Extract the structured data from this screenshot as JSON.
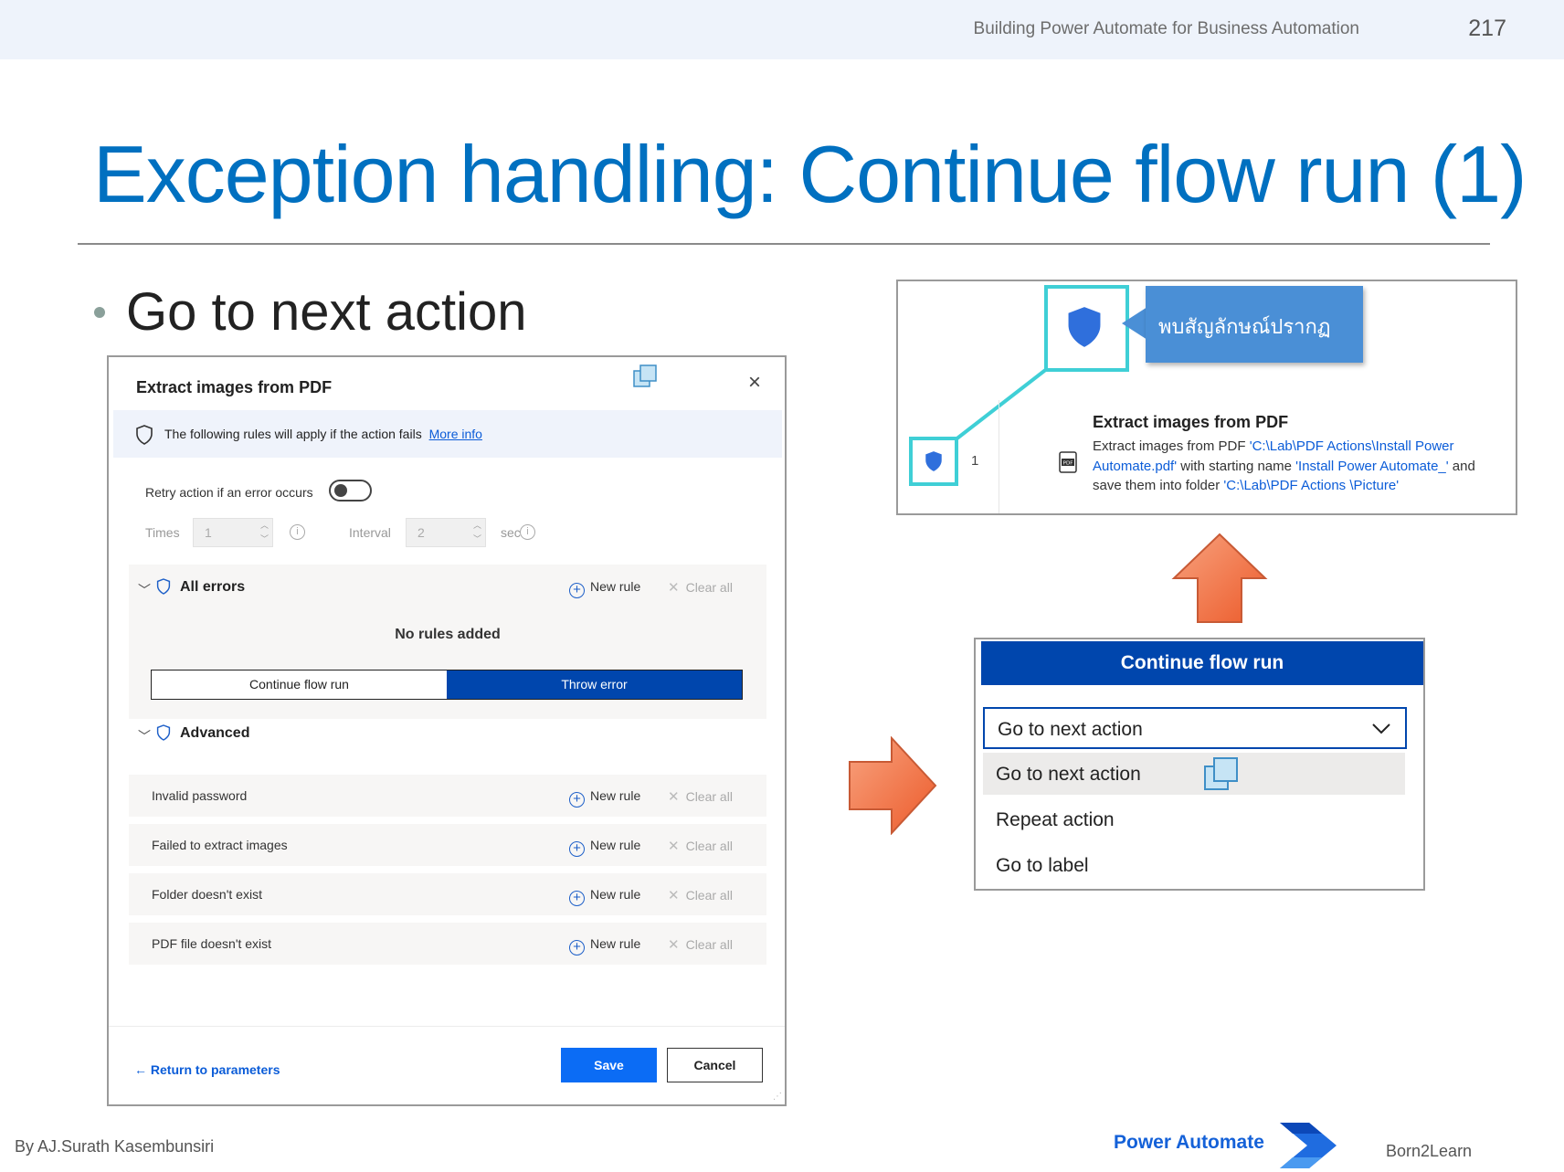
{
  "header": {
    "book_title": "Building Power Automate for Business Automation",
    "page_number": "217"
  },
  "slide": {
    "title": "Exception handling: Continue flow run (1)",
    "bullet": "Go to next action"
  },
  "dialog": {
    "title": "Extract images from PDF",
    "info_text": "The following rules will apply if the action fails",
    "info_link": "More info",
    "retry_label": "Retry action if an error occurs",
    "retry_enabled": false,
    "times_label": "Times",
    "times_value": "1",
    "interval_label": "Interval",
    "interval_value": "2",
    "interval_unit": "sec",
    "all_errors": {
      "heading": "All errors",
      "new_rule": "New rule",
      "clear_all": "Clear all",
      "empty_text": "No rules added",
      "continue_label": "Continue flow run",
      "throw_label": "Throw error"
    },
    "advanced": {
      "heading": "Advanced",
      "rows": [
        {
          "label": "Invalid password",
          "new_rule": "New rule",
          "clear_all": "Clear all"
        },
        {
          "label": "Failed to extract images",
          "new_rule": "New rule",
          "clear_all": "Clear all"
        },
        {
          "label": "Folder doesn't exist",
          "new_rule": "New rule",
          "clear_all": "Clear all"
        },
        {
          "label": "PDF file doesn't exist",
          "new_rule": "New rule",
          "clear_all": "Clear all"
        }
      ]
    },
    "return_link": "Return to parameters",
    "save_label": "Save",
    "cancel_label": "Cancel"
  },
  "flow_step": {
    "callout": "พบสัญลักษณ์ปรากฏ",
    "step_number": "1",
    "action_title": "Extract images from PDF",
    "desc_1": "Extract images from PDF ",
    "desc_path1": "'C:\\Lab\\PDF Actions\\Install Power Automate.pdf'",
    "desc_2": " with starting name ",
    "desc_name": "'Install Power Automate_'",
    "desc_3": " and save them into folder ",
    "desc_path2": "'C:\\Lab\\PDF Actions \\Picture'"
  },
  "continue_dropdown": {
    "header": "Continue flow run",
    "selected": "Go to next action",
    "options": [
      "Go to next action",
      "Repeat action",
      "Go to label"
    ]
  },
  "footer": {
    "author": "By AJ.Surath Kasembunsiri",
    "product": "Power Automate",
    "brand": "Born2Learn"
  },
  "colors": {
    "title_blue": "#0070c0",
    "brand_blue": "#0046ad",
    "highlight_cyan": "#3fcfd6",
    "arrow_orange": "#f2754a"
  }
}
